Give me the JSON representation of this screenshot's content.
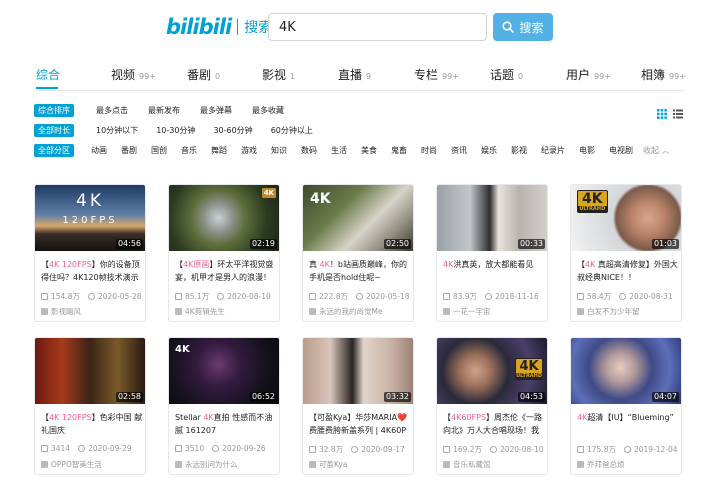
{
  "logo": {
    "main": "bilibili",
    "sub": "搜索"
  },
  "search": {
    "value": "4K",
    "button_label": "搜索"
  },
  "tabs": [
    {
      "label": "综合",
      "count": ""
    },
    {
      "label": "视频",
      "count": "99+"
    },
    {
      "label": "番剧",
      "count": "0"
    },
    {
      "label": "影视",
      "count": "1"
    },
    {
      "label": "直播",
      "count": "9"
    },
    {
      "label": "专栏",
      "count": "99+"
    },
    {
      "label": "话题",
      "count": "0"
    },
    {
      "label": "用户",
      "count": "99+"
    },
    {
      "label": "相簿",
      "count": "99+"
    }
  ],
  "filters": {
    "order": {
      "active": "综合排序",
      "options": [
        "最多点击",
        "最新发布",
        "最多弹幕",
        "最多收藏"
      ]
    },
    "duration": {
      "active": "全部时长",
      "options": [
        "10分钟以下",
        "10-30分钟",
        "30-60分钟",
        "60分钟以上"
      ]
    },
    "zone": {
      "active": "全部分区",
      "options": [
        "动画",
        "番剧",
        "国创",
        "音乐",
        "舞蹈",
        "游戏",
        "知识",
        "数码",
        "生活",
        "美食",
        "鬼畜",
        "时尚",
        "资讯",
        "娱乐",
        "影视",
        "纪录片",
        "电影",
        "电视剧"
      ],
      "collapse_label": "收起"
    }
  },
  "videos": [
    {
      "hl": "4K 120FPS",
      "title": "】你的设备顶得住吗？4K120帧技术演示",
      "pre": "【",
      "duration": "04:56",
      "views": "154.8万",
      "date": "2020-05-28",
      "author": "影视飓风",
      "thumb_text": "4K",
      "thumb_sub": "120FPS"
    },
    {
      "hl": "4K原画",
      "title": "】环太平洋视觉盛宴，机甲才是男人的浪漫！",
      "pre": "【",
      "duration": "02:19",
      "views": "85.1万",
      "date": "2020-08-10",
      "author": "4K剪辑先生",
      "thumb_text": "4K"
    },
    {
      "hl": "4K",
      "title": "！b站画质巅峰，你的手机是否hold住呢~",
      "pre": "真 ",
      "duration": "02:50",
      "views": "222.8万",
      "date": "2020-05-18",
      "author": "永远的我的尚觉Me",
      "thumb_text": "4K"
    },
    {
      "hl": "4K",
      "title": "洪真英，放大都能看见",
      "pre": "",
      "duration": "00:33",
      "views": "83.9万",
      "date": "2018-11-16",
      "author": "一花一宇宙"
    },
    {
      "hl": "4K",
      "title": " 真超高清修复】外国大叔经典NICE！！",
      "pre": "【",
      "duration": "01:03",
      "views": "58.4万",
      "date": "2020-08-31",
      "author": "白发不为少年留",
      "thumb_text": "4K",
      "thumb_sub": "ULTRAHD"
    },
    {
      "hl": "4K 120FPS",
      "title": "】色彩中国 献礼国庆",
      "pre": "【",
      "duration": "02:58",
      "views": "3414",
      "date": "2020-09-29",
      "author": "OPPO智美生活"
    },
    {
      "hl": "4K",
      "title": "直拍 性感而不油腻 161207",
      "pre": "Stellar ",
      "duration": "06:52",
      "views": "3510",
      "date": "2020-09-26",
      "author": "永远别问为什么",
      "thumb_text": "4K"
    },
    {
      "hl": "",
      "title": "【可盈Kya】华莎MARIA❤️费腰费胯新盖系列 | 4K60P",
      "pre": "",
      "duration": "03:32",
      "views": "32.8万",
      "date": "2020-09-17",
      "author": "可盈Kya"
    },
    {
      "hl": "4K60FPS",
      "title": "】周杰伦《一路向北》万人大合唱现场！我",
      "pre": "【",
      "duration": "04:53",
      "views": "169.2万",
      "date": "2020-08-10",
      "author": "音乐私藏馆",
      "thumb_text": "4K",
      "thumb_sub": "ULTRAHD"
    },
    {
      "hl": "4K",
      "title": "超清【IU】“Blueming”",
      "pre": "",
      "duration": "04:07",
      "views": "175.8万",
      "date": "2019-12-04",
      "author": "乔拜爸总烦"
    }
  ]
}
